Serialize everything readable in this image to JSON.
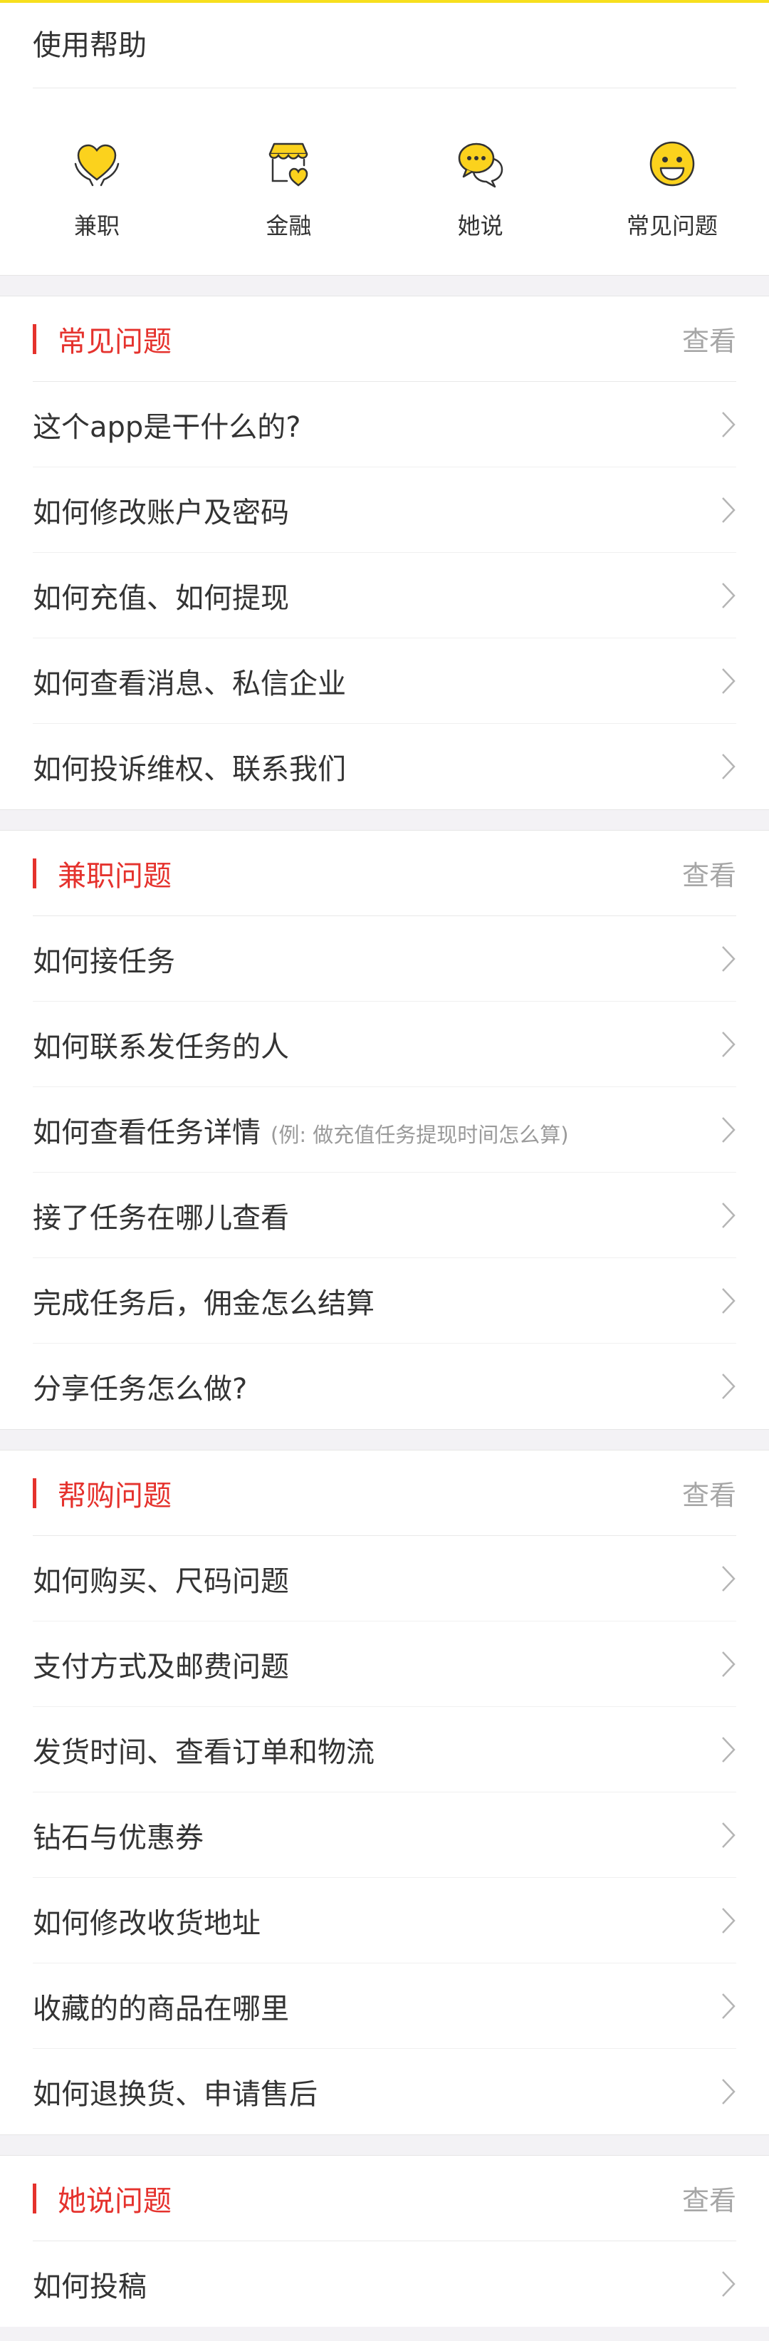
{
  "header": {
    "title": "使用帮助"
  },
  "quick_links": [
    {
      "label": "兼职",
      "icon": "heart-hands-icon"
    },
    {
      "label": "金融",
      "icon": "shop-heart-icon"
    },
    {
      "label": "她说",
      "icon": "chat-bubbles-icon"
    },
    {
      "label": "常见问题",
      "icon": "smiley-icon"
    }
  ],
  "sections": [
    {
      "title": "常见问题",
      "view_label": "查看",
      "items": [
        {
          "text": "这个app是干什么的?"
        },
        {
          "text": "如何修改账户及密码"
        },
        {
          "text": "如何充值、如何提现"
        },
        {
          "text": "如何查看消息、私信企业"
        },
        {
          "text": "如何投诉维权、联系我们"
        }
      ]
    },
    {
      "title": "兼职问题",
      "view_label": "查看",
      "items": [
        {
          "text": "如何接任务"
        },
        {
          "text": "如何联系发任务的人"
        },
        {
          "text": "如何查看任务详情",
          "note": "(例:  做充值任务提现时间怎么算)"
        },
        {
          "text": "接了任务在哪儿查看"
        },
        {
          "text": "完成任务后，佣金怎么结算"
        },
        {
          "text": "分享任务怎么做?"
        }
      ]
    },
    {
      "title": "帮购问题",
      "view_label": "查看",
      "items": [
        {
          "text": "如何购买、尺码问题"
        },
        {
          "text": "支付方式及邮费问题"
        },
        {
          "text": "发货时间、查看订单和物流"
        },
        {
          "text": "钻石与优惠券"
        },
        {
          "text": "如何修改收货地址"
        },
        {
          "text": "收藏的的商品在哪里"
        },
        {
          "text": "如何退换货、申请售后"
        }
      ]
    },
    {
      "title": "她说问题",
      "view_label": "查看",
      "items": [
        {
          "text": "如何投稿"
        }
      ]
    }
  ],
  "colors": {
    "accent": "#e5322d",
    "icon_yellow": "#fbd21d",
    "top_line": "#f7df1e"
  }
}
